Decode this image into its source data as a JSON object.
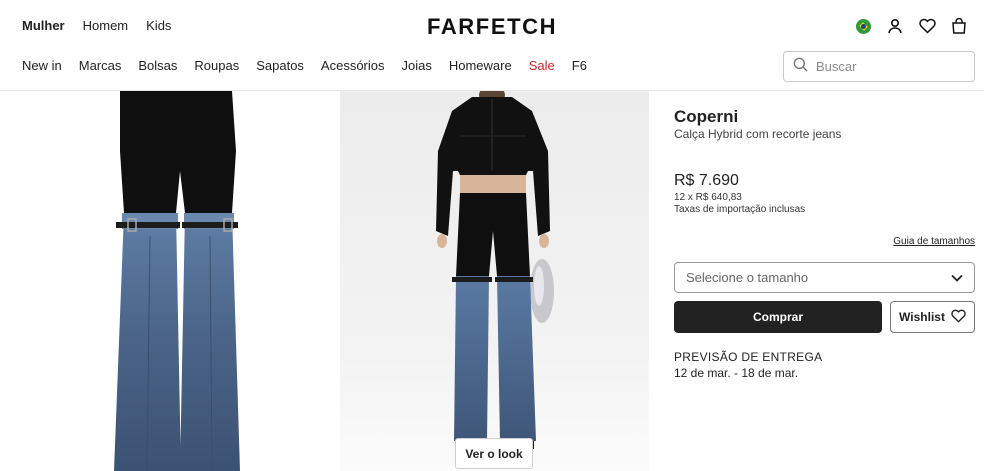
{
  "header": {
    "gender_tabs": [
      {
        "label": "Mulher",
        "active": true
      },
      {
        "label": "Homem",
        "active": false
      },
      {
        "label": "Kids",
        "active": false
      }
    ],
    "logo": "FARFETCH",
    "icons": [
      "brazil-flag-icon",
      "account-icon",
      "heart-icon",
      "bag-icon"
    ]
  },
  "nav": {
    "items": [
      "New in",
      "Marcas",
      "Bolsas",
      "Roupas",
      "Sapatos",
      "Acessórios",
      "Joias",
      "Homeware",
      "Sale",
      "F6"
    ],
    "sale_color": "#c62828"
  },
  "search": {
    "placeholder": "Buscar"
  },
  "gallery": {
    "view_look_label": "Ver o look"
  },
  "product": {
    "brand": "Coperni",
    "name": "Calça Hybrid com recorte jeans",
    "price": "R$ 7.690",
    "installments": "12 x R$ 640,83",
    "taxes": "Taxas de importação inclusas",
    "size_guide": "Guia de tamanhos",
    "size_placeholder": "Selecione o tamanho",
    "buy_label": "Comprar",
    "wishlist_label": "Wishlist",
    "delivery_title": "PREVISÃO DE ENTREGA",
    "delivery_dates": "12 de mar. - 18 de mar."
  },
  "colors": {
    "accent": "#222222",
    "sale": "#c62828",
    "denim": "#4a6386"
  }
}
